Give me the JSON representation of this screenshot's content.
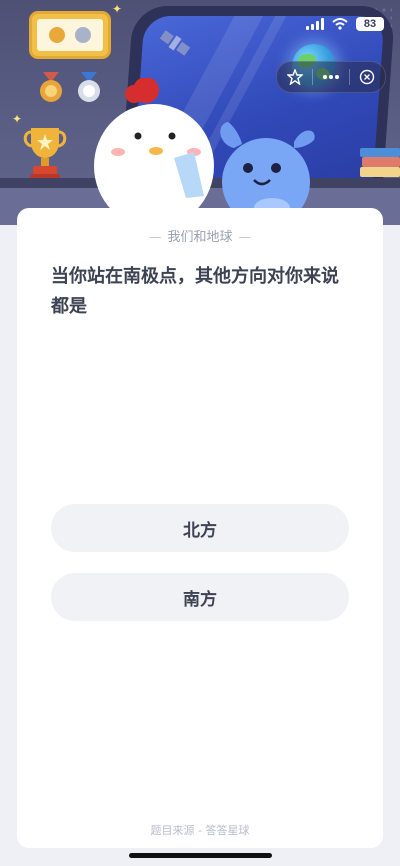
{
  "status_bar": {
    "battery": "83"
  },
  "quiz": {
    "category": "我们和地球",
    "question": "当你站在南极点，其他方向对你来说都是",
    "options": [
      {
        "label": "北方"
      },
      {
        "label": "南方"
      }
    ],
    "source": "题目来源 - 答答星球"
  },
  "colors": {
    "hero_background": "#5b5f86",
    "card_background": "#ffffff",
    "option_background": "#f1f2f6",
    "question_text": "#3d4352"
  },
  "icons": [
    "star-icon",
    "more-icon",
    "close-icon",
    "signal-icon",
    "wifi-icon",
    "battery-icon"
  ]
}
